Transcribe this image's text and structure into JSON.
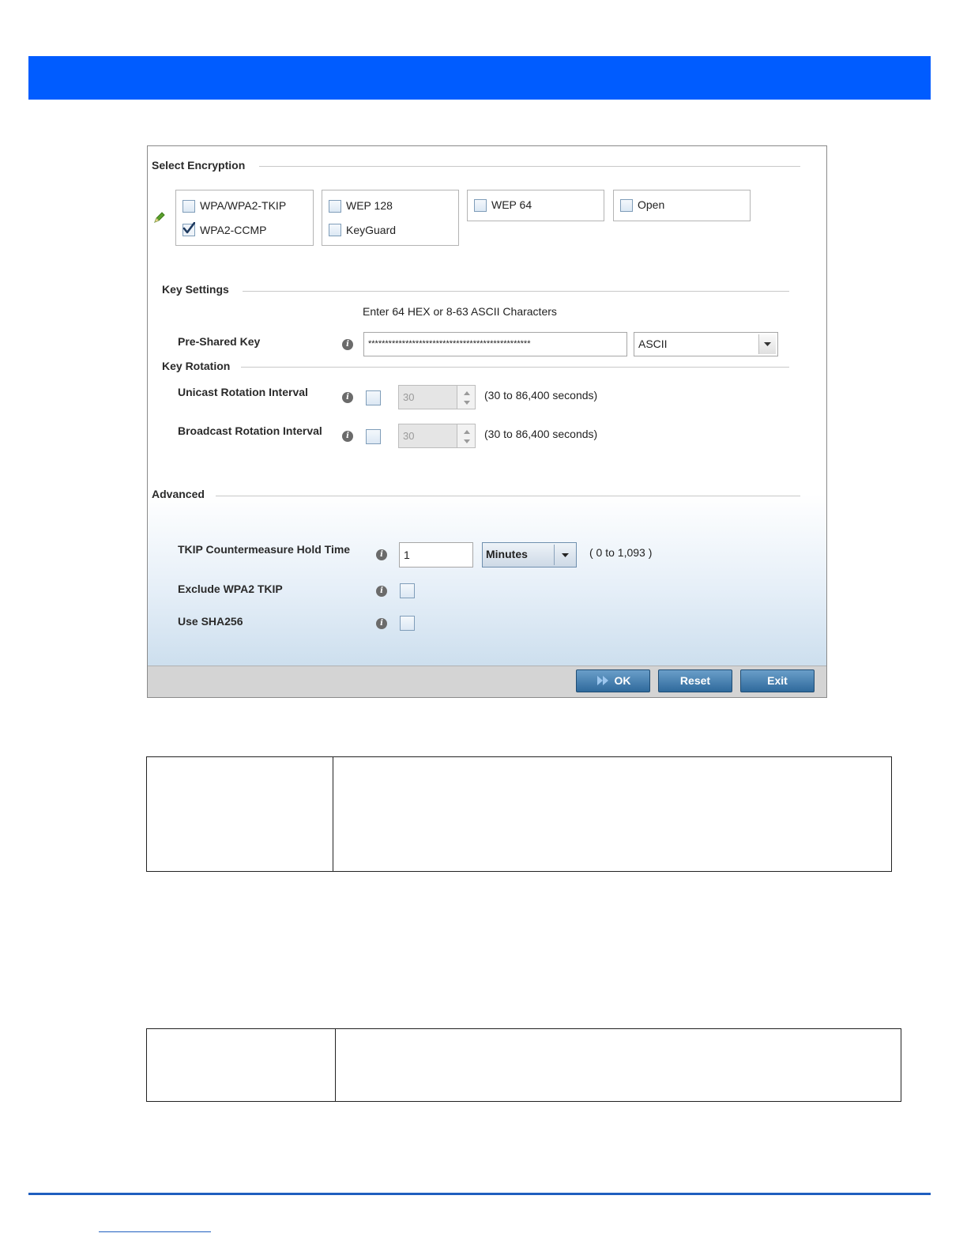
{
  "colors": {
    "header_blue": "#005cff",
    "button_blue": "#2f6a9c",
    "rule_blue": "#1f5fbf"
  },
  "encryption": {
    "section_title": "Select Encryption",
    "options": [
      {
        "label": "WPA/WPA2-TKIP",
        "checked": false
      },
      {
        "label": "WPA2-CCMP",
        "checked": true
      },
      {
        "label": "WEP 128",
        "checked": false
      },
      {
        "label": "KeyGuard",
        "checked": false
      },
      {
        "label": "WEP 64",
        "checked": false
      },
      {
        "label": "Open",
        "checked": false
      }
    ]
  },
  "key_settings": {
    "section_title": "Key Settings",
    "hint": "Enter 64 HEX or 8-63 ASCII Characters",
    "psk_label": "Pre-Shared Key",
    "psk_value": "************************************************",
    "psk_format": "ASCII"
  },
  "key_rotation": {
    "section_title": "Key Rotation",
    "unicast_label": "Unicast Rotation Interval",
    "unicast_value": "30",
    "unicast_range": "(30 to 86,400 seconds)",
    "broadcast_label": "Broadcast Rotation Interval",
    "broadcast_value": "30",
    "broadcast_range": "(30 to 86,400 seconds)"
  },
  "advanced": {
    "section_title": "Advanced",
    "tkip_label": "TKIP Countermeasure Hold Time",
    "tkip_value": "1",
    "tkip_unit": "Minutes",
    "tkip_range": "( 0 to 1,093 )",
    "exclude_label": "Exclude WPA2 TKIP",
    "sha_label": "Use SHA256"
  },
  "buttons": {
    "ok": "OK",
    "reset": "Reset",
    "exit": "Exit"
  },
  "icons": {
    "edit": "pencil-icon",
    "info": "info-icon",
    "dropdown": "chevron-down-icon",
    "ok": "double-arrow-icon"
  }
}
